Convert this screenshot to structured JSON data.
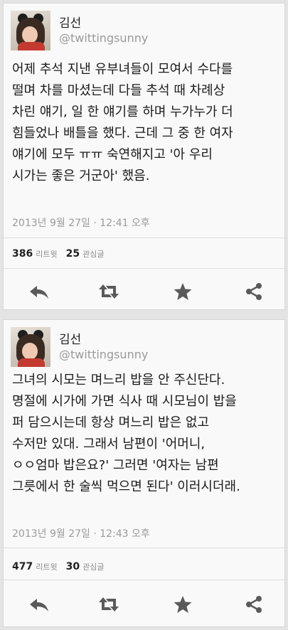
{
  "tweets": [
    {
      "name": "김선",
      "handle": "@twittingsunny",
      "text": "어제 추석 지낸 유부녀들이 모여서 수다를\n떨며 차를 마셨는데 다들 추석 때 차례상\n차린 얘기, 일 한 얘기를 하며 누가누가 더\n힘들었나 배틀을 했다. 근데 그 중 한 여자\n얘기에 모두 ㅠㅠ 숙연해지고 '아 우리\n시가는 좋은 거군아' 했음.",
      "timestamp": "2013년 9월 27일 · 12:41 오후",
      "retweets": "386",
      "retweets_label": "리트윗",
      "favorites": "25",
      "favorites_label": "관심글"
    },
    {
      "name": "김선",
      "handle": "@twittingsunny",
      "text": "그녀의 시모는 며느리 밥을 안 주신단다.\n명절에 시가에 가면 식사 때 시모님이 밥을\n퍼 담으시는데 항상 며느리 밥은 없고\n수저만 있대. 그래서 남편이 '어머니,\nㅇㅇ엄마 밥은요?' 그러면 '여자는 남편\n그릇에서 한 술씩 먹으면 된다' 이러시더래.",
      "timestamp": "2013년 9월 27일 · 12:43 오후",
      "retweets": "477",
      "retweets_label": "리트윗",
      "favorites": "30",
      "favorites_label": "관심글"
    }
  ],
  "icons": [
    "reply-icon",
    "retweet-icon",
    "favorite-star-icon",
    "share-icon"
  ],
  "colors": {
    "icon": "#5a5a5a",
    "handle": "#9a9a9a",
    "text": "#1a1a1a"
  }
}
